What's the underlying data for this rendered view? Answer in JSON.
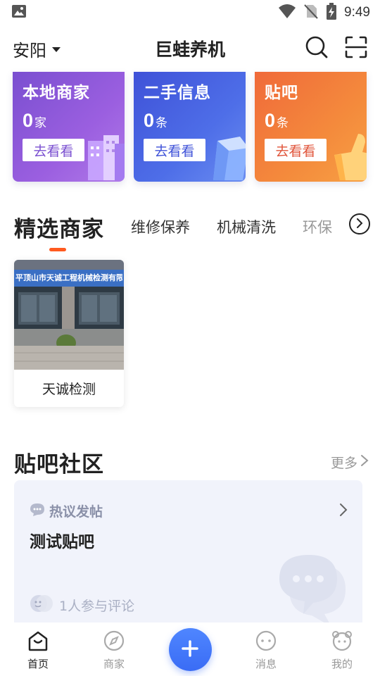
{
  "status_bar": {
    "time": "9:49"
  },
  "header": {
    "city": "安阳",
    "title": "巨蛙养机"
  },
  "categories": [
    {
      "title": "本地商家",
      "count": "0",
      "unit": "家",
      "button": "去看看"
    },
    {
      "title": "二手信息",
      "count": "0",
      "unit": "条",
      "button": "去看看"
    },
    {
      "title": "贴吧",
      "count": "0",
      "unit": "条",
      "button": "去看看"
    }
  ],
  "merchant_tabs": {
    "selected": "精选商家",
    "tabs": [
      "维修保养",
      "机械清洗",
      "环保"
    ]
  },
  "merchants": [
    {
      "name": "天诚检测",
      "sign_text": "平顶山市天诚工程机械检测有限公司"
    }
  ],
  "community": {
    "title": "贴吧社区",
    "more": "更多",
    "hot_label": "热议发帖",
    "post_title": "测试贴吧",
    "participants": "1人参与评论"
  },
  "bottom_nav": {
    "items": [
      {
        "label": "首页",
        "icon": "home-icon",
        "active": true
      },
      {
        "label": "商家",
        "icon": "compass-icon",
        "active": false
      },
      {
        "label": "",
        "icon": "plus-icon",
        "active": false
      },
      {
        "label": "消息",
        "icon": "message-icon",
        "active": false
      },
      {
        "label": "我的",
        "icon": "profile-icon",
        "active": false
      }
    ]
  },
  "colors": {
    "accent": "#ff5a1f",
    "fab": "#3a6cf5",
    "card_purple": "#7a4fd0",
    "card_blue": "#3f52d8",
    "card_orange": "#f06a3a"
  }
}
